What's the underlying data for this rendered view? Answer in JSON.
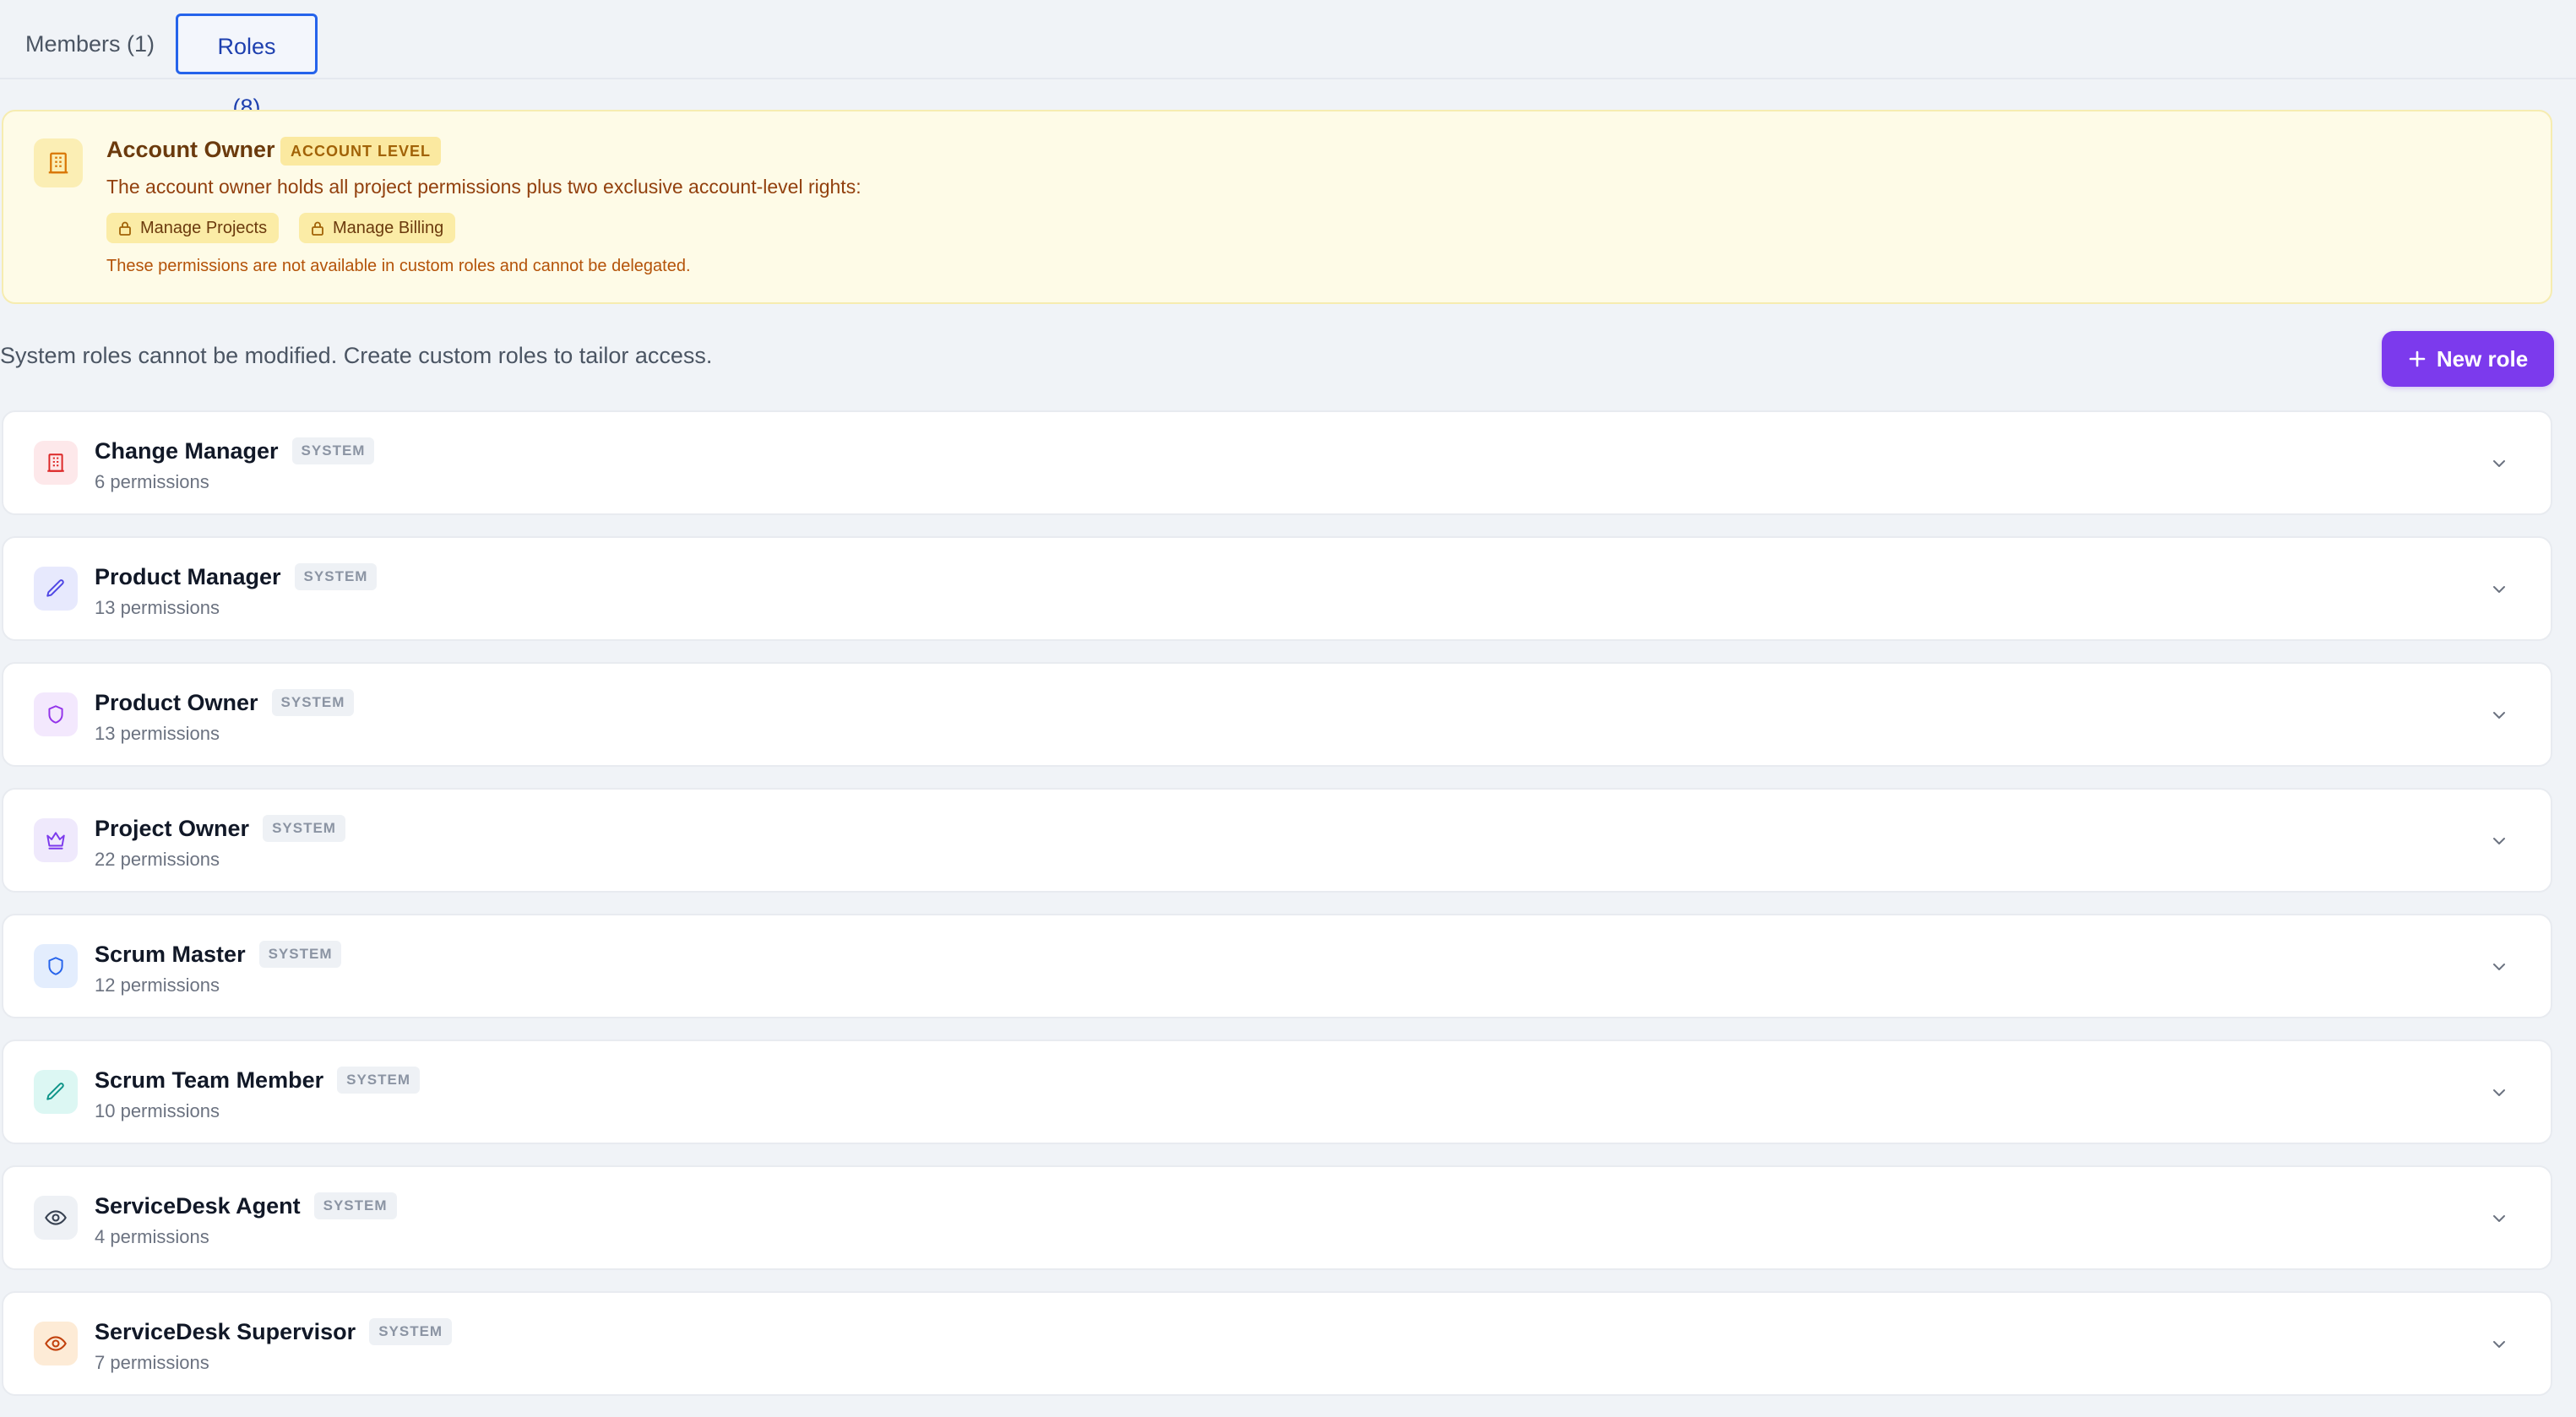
{
  "tabs": {
    "members": "Members (1)",
    "roles": "Roles (8)"
  },
  "banner": {
    "title": "Account Owner",
    "badge": "ACCOUNT LEVEL",
    "description": "The account owner holds all project permissions plus two exclusive account-level rights:",
    "rights": [
      "Manage Projects",
      "Manage Billing"
    ],
    "note": "These permissions are not available in custom roles and cannot be delegated.",
    "icon": "building-icon"
  },
  "intro": "System roles cannot be modified. Create custom roles to tailor access.",
  "new_role_button": "New role",
  "system_badge": "SYSTEM",
  "roles": [
    {
      "name": "Change Manager",
      "permissions": "6 permissions",
      "icon": "building-icon",
      "color": "#dc2626",
      "bg": "#fde8ea"
    },
    {
      "name": "Product Manager",
      "permissions": "13 permissions",
      "icon": "pencil-icon",
      "color": "#4f46e5",
      "bg": "#e7e9fd"
    },
    {
      "name": "Product Owner",
      "permissions": "13 permissions",
      "icon": "shield-icon",
      "color": "#9333ea",
      "bg": "#f3e8fd"
    },
    {
      "name": "Project Owner",
      "permissions": "22 permissions",
      "icon": "crown-icon",
      "color": "#7c3aed",
      "bg": "#efe9fc"
    },
    {
      "name": "Scrum Master",
      "permissions": "12 permissions",
      "icon": "shield-icon",
      "color": "#2563eb",
      "bg": "#e3edfd"
    },
    {
      "name": "Scrum Team Member",
      "permissions": "10 permissions",
      "icon": "pencil-icon",
      "color": "#0d9488",
      "bg": "#dcf7f3"
    },
    {
      "name": "ServiceDesk Agent",
      "permissions": "4 permissions",
      "icon": "eye-icon",
      "color": "#374151",
      "bg": "#eef1f5"
    },
    {
      "name": "ServiceDesk Supervisor",
      "permissions": "7 permissions",
      "icon": "eye-icon",
      "color": "#c2410c",
      "bg": "#fdebd6"
    }
  ]
}
